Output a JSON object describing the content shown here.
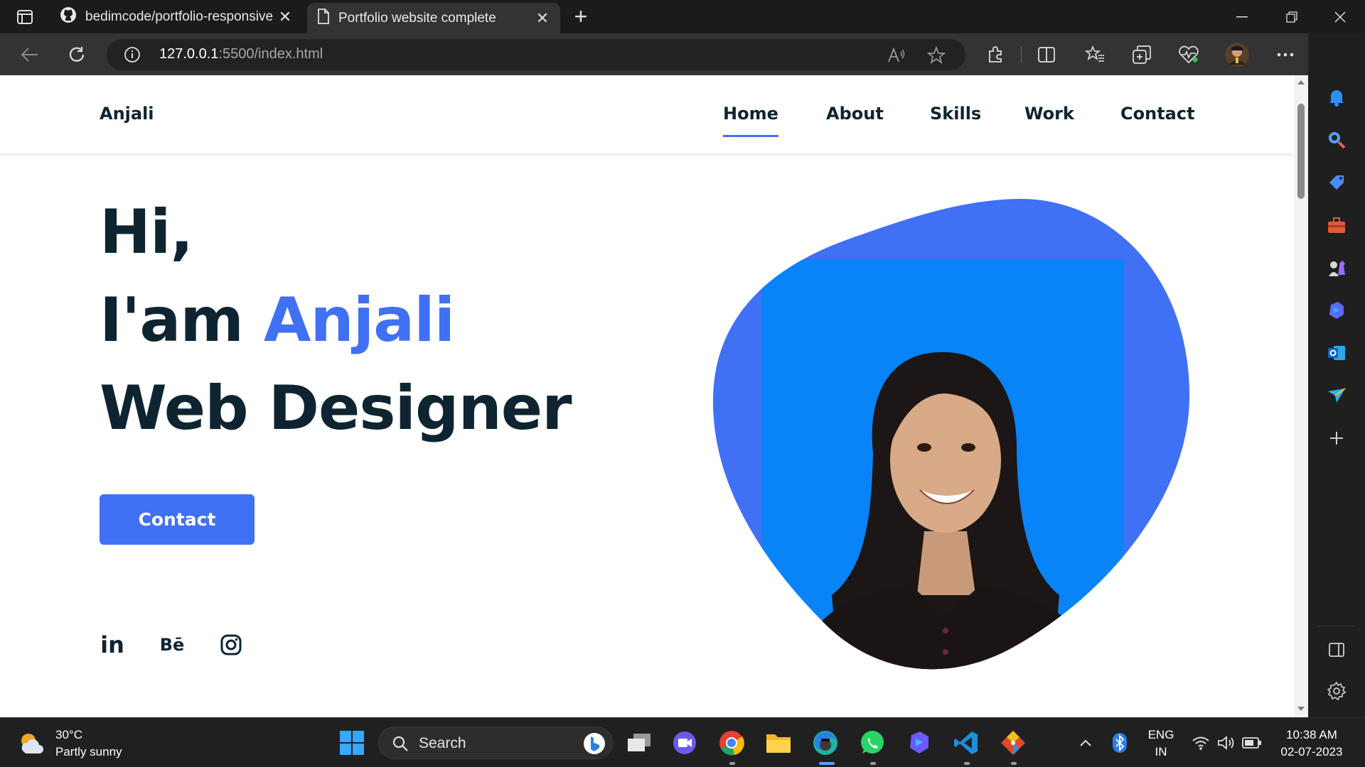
{
  "browser": {
    "tabs": [
      {
        "title": "bedimcode/portfolio-responsive",
        "icon": "github-icon"
      },
      {
        "title": "Portfolio website complete",
        "icon": "document-icon"
      }
    ],
    "address": {
      "host": "127.0.0.1",
      "path": ":5500/index.html"
    },
    "toolbar_icons": [
      "back-icon",
      "refresh-icon",
      "read-aloud-icon",
      "favorite-star-icon",
      "extensions-icon",
      "split-screen-icon",
      "favorites-icon",
      "collections-icon",
      "performance-icon",
      "profile-avatar",
      "more-icon",
      "copilot-icon"
    ],
    "sidebar_icons": [
      "notifications-icon",
      "search-icon",
      "shopping-icon",
      "tools-icon",
      "games-icon",
      "copilot-bing-icon",
      "outlook-icon",
      "send-icon",
      "add-icon",
      "sidebar-toggle-icon",
      "settings-icon"
    ]
  },
  "page": {
    "logo": "Anjali",
    "nav": [
      "Home",
      "About",
      "Skills",
      "Work",
      "Contact"
    ],
    "active_nav": "Home",
    "hero": {
      "line1": "Hi,",
      "line2_prefix": "I'am ",
      "line2_name": "Anjali",
      "line3": "Web Designer"
    },
    "cta_label": "Contact",
    "social": {
      "linkedin": "in",
      "behance": "Bē",
      "instagram": "instagram-icon"
    },
    "accent_color": "#4070f4",
    "text_color": "#0e2431"
  },
  "taskbar": {
    "weather_temp": "30°C",
    "weather_desc": "Partly sunny",
    "search_label": "Search",
    "lang_line1": "ENG",
    "lang_line2": "IN",
    "time": "10:38 AM",
    "date": "02-07-2023",
    "apps": [
      "windows-start-icon",
      "task-view-icon",
      "meet-icon",
      "chrome-icon",
      "file-explorer-icon",
      "edge-icon",
      "whatsapp-icon",
      "copilot-icon",
      "vscode-icon",
      "git-icon"
    ]
  }
}
